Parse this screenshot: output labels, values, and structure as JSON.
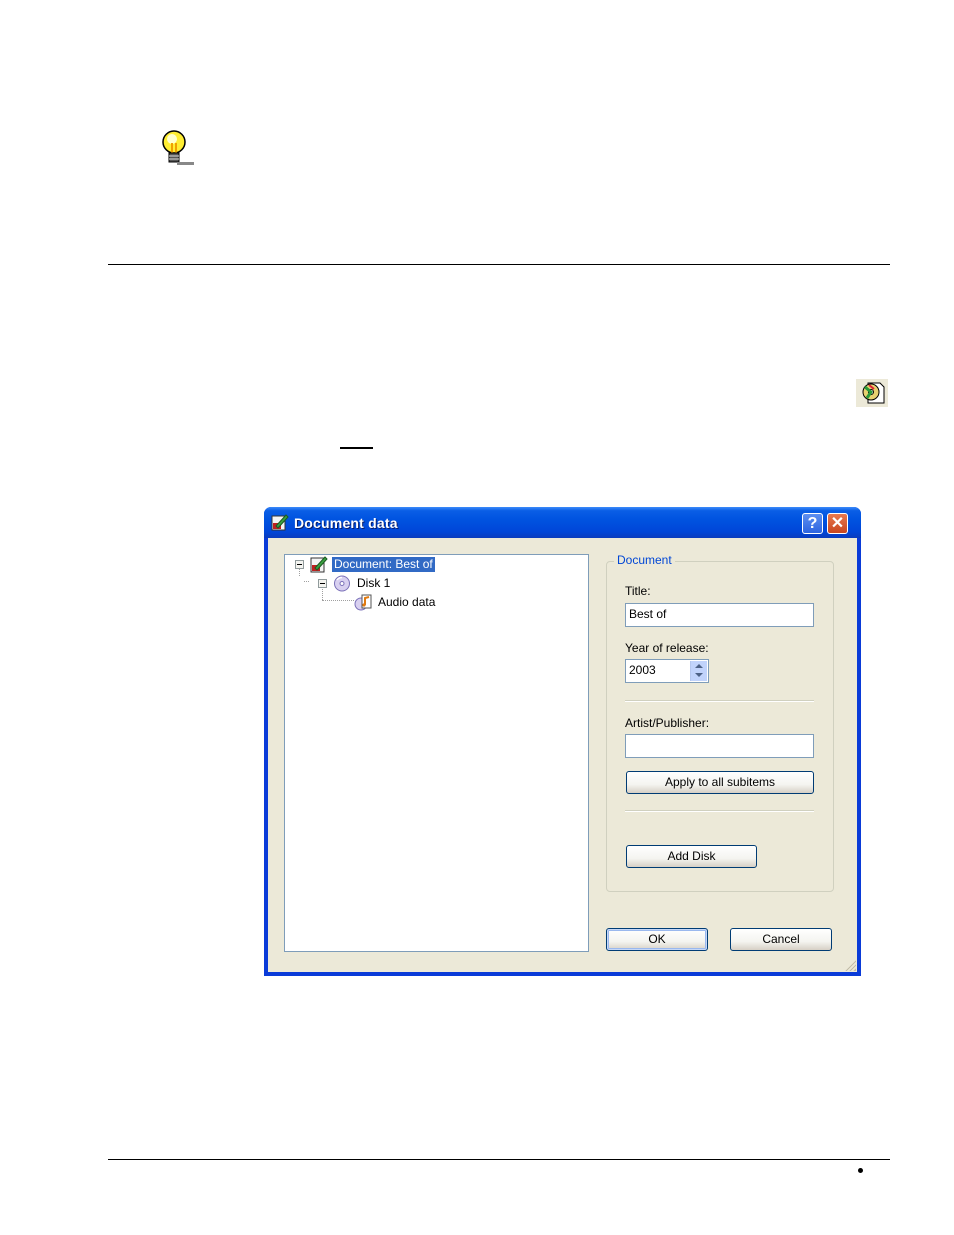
{
  "page": {
    "icons": {
      "tip": "lightbulb-tip-icon",
      "toolbar": "document-data-toolbar-icon"
    }
  },
  "dialog": {
    "title": "Document data",
    "title_icon": "document-edit-icon",
    "help_label": "?",
    "close_label": "✕",
    "tree": {
      "items": [
        {
          "label": "Document: Best of",
          "icon": "document-edit-icon",
          "expanded": true,
          "selected": true,
          "level": 0
        },
        {
          "label": "Disk 1",
          "icon": "cd-disk-icon",
          "expanded": true,
          "selected": false,
          "level": 1
        },
        {
          "label": "Audio data",
          "icon": "audio-file-icon",
          "selected": false,
          "level": 2
        }
      ]
    },
    "group": {
      "legend": "Document",
      "title_label": "Title:",
      "title_value": "Best of",
      "year_label": "Year of release:",
      "year_value": "2003",
      "artist_label": "Artist/Publisher:",
      "artist_value": "",
      "apply_button": "Apply to all subitems",
      "add_disk_button": "Add Disk"
    },
    "ok_button": "OK",
    "cancel_button": "Cancel"
  }
}
